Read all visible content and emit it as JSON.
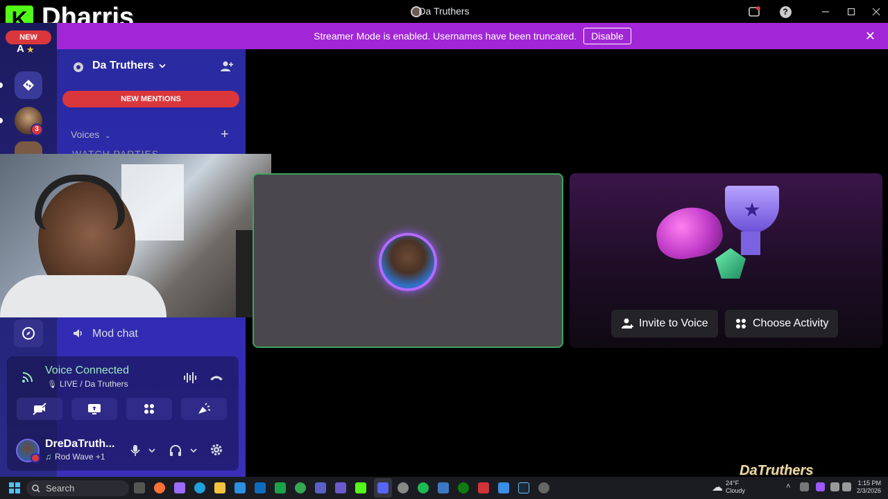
{
  "window": {
    "title": "Da Truthers",
    "help_glyph": "?"
  },
  "overlay_logo": {
    "letter": "K",
    "name": "Dharris",
    "badge": "NEW"
  },
  "banner": {
    "text": "Streamer Mode is enabled. Usernames have been truncated.",
    "button": "Disable"
  },
  "rail": {
    "top_initial": "A",
    "badge_count": "3"
  },
  "server": {
    "name": "Da Truthers",
    "mentions": "NEW MENTIONS",
    "voices_label": "Voices",
    "partial_channel": "WATCH PARTIES",
    "mod_chat": "Mod chat"
  },
  "voice": {
    "status": "Voice Connected",
    "channel": "LIVE / Da Truthers"
  },
  "user": {
    "name": "DreDaTruth...",
    "activity": "Rod Wave +1"
  },
  "stage": {
    "invite": "Invite to Voice",
    "choose": "Choose Activity"
  },
  "watermark": "DaTruthers",
  "taskbar": {
    "search": "Search",
    "weather_temp": "24°F",
    "weather_desc": "Cloudy",
    "time": "1:15 PM",
    "date": "2/3/2026"
  },
  "colors": {
    "banner": "#a127d6",
    "mentions": "#da373c",
    "speaking_border": "#3ba55d",
    "voice_connected": "#9ee7c3"
  }
}
